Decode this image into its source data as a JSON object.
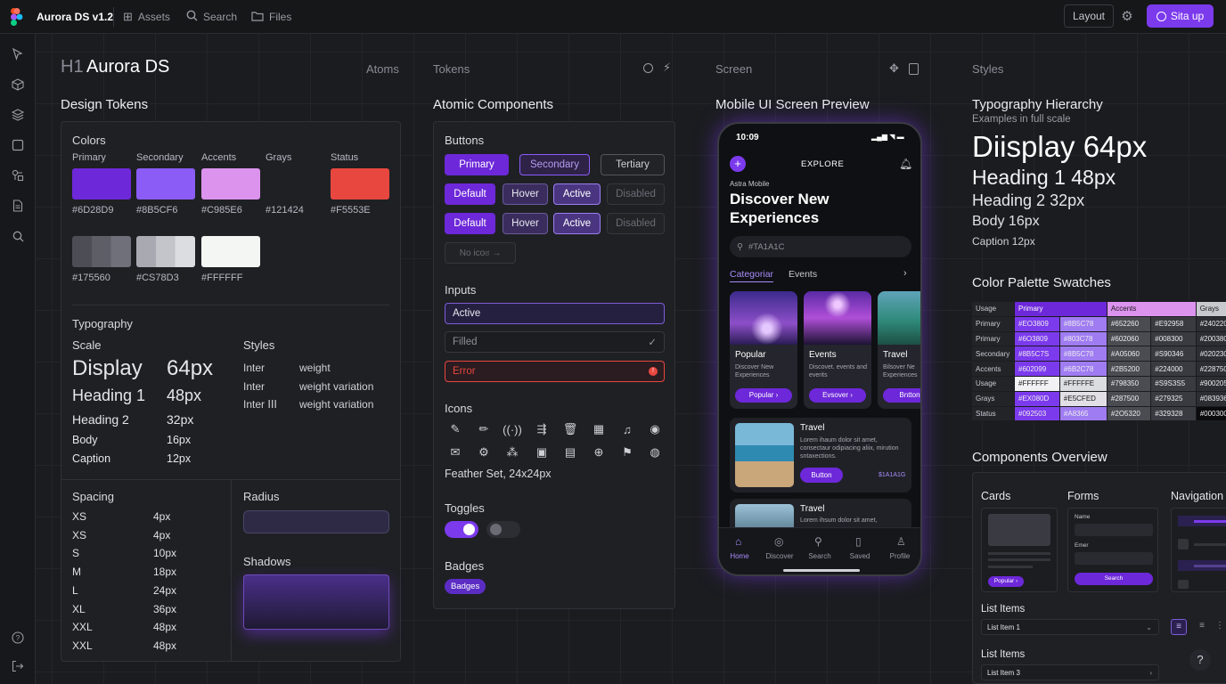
{
  "topbar": {
    "app_title": "Aurora DS v1.2",
    "assets": "Assets",
    "search": "Search",
    "files": "Files",
    "layout": "Layout",
    "signup": "Sita up"
  },
  "canvas_headers": {
    "title_prefix": "H1",
    "title": "Aurora DS",
    "atoms": "Atoms",
    "tokens": "Tokens",
    "screen": "Screen",
    "styles": "Styles"
  },
  "tokens": {
    "title": "Design Tokens",
    "colors_title": "Colors",
    "swatches": [
      {
        "name": "Primary",
        "hex": "#6D28D9",
        "color": "#6d28d9"
      },
      {
        "name": "Secondary",
        "hex": "#8B5CF6",
        "color": "#8b5cf6"
      },
      {
        "name": "Accents",
        "hex": "#C985E6",
        "color": "#dc93ee"
      },
      {
        "name": "Grays",
        "hex": "#121424",
        "color": "#1f2024"
      },
      {
        "name": "Status",
        "hex": "#F5553E",
        "color": "#e8473f"
      }
    ],
    "grays": [
      {
        "hex": "#175560"
      },
      {
        "hex": "#CS78D3"
      },
      {
        "hex": "#FFFFFF"
      }
    ],
    "typography_title": "Typography",
    "scale_title": "Scale",
    "styles_title": "Styles",
    "scale": [
      {
        "name": "Display",
        "size": "64px"
      },
      {
        "name": "Heading 1",
        "size": "48px"
      },
      {
        "name": "Heading 2",
        "size": "32px"
      },
      {
        "name": "Body",
        "size": "16px"
      },
      {
        "name": "Caption",
        "size": "12px"
      }
    ],
    "styles": [
      {
        "font": "Inter",
        "desc": "weight"
      },
      {
        "font": "Inter",
        "desc": "weight variation"
      },
      {
        "font": "Inter ⅠⅠⅠ",
        "desc": "weight variation"
      }
    ],
    "spacing_title": "Spacing",
    "spacing": [
      {
        "k": "XS",
        "v": "4px"
      },
      {
        "k": "XS",
        "v": "4px"
      },
      {
        "k": "S",
        "v": "10px"
      },
      {
        "k": "M",
        "v": "18px"
      },
      {
        "k": "L",
        "v": "24px"
      },
      {
        "k": "XL",
        "v": "36px"
      },
      {
        "k": "XXL",
        "v": "48px"
      },
      {
        "k": "XXL",
        "v": "48px"
      }
    ],
    "radius_title": "Radius",
    "shadows_title": "Shadows"
  },
  "atomic": {
    "title": "Atomic Components",
    "buttons_title": "Buttons",
    "row1": [
      "Primary",
      "Secondary",
      "Tertiary"
    ],
    "row2": [
      "Default",
      "Hover",
      "Active",
      "Disabled"
    ],
    "row3": [
      "Default",
      "Hover",
      "Active",
      "Disabled"
    ],
    "no_icon": "No icoಠ →",
    "inputs_title": "Inputs",
    "input_active": "Active",
    "input_filled": "Filled",
    "input_error": "Error",
    "icons_title": "Icons",
    "icons_caption": "Feather Set, 24x24px",
    "toggles_title": "Toggles",
    "badges_title": "Badges",
    "badge_label": "Badges"
  },
  "mobile": {
    "title": "Mobile UI Screen Preview",
    "time": "10:09",
    "header": "EXPLORE",
    "app_name": "Astra Mobile",
    "headline_1": "Discover New",
    "headline_2": "Experiences",
    "search_placeholder": "#TA1A1C",
    "tab_categories": "Categoriar",
    "tab_events": "Events",
    "cards": [
      {
        "title": "Popular",
        "desc": "Discover New Experiences",
        "button": "Popular ›"
      },
      {
        "title": "Events",
        "desc": "Discovet. events and everits",
        "button": "Evsover ›"
      },
      {
        "title": "Travel",
        "desc": "Bilsover Ne Experiences",
        "button": "Bnttons"
      }
    ],
    "list": [
      {
        "title": "Travel",
        "desc": "Lorem ihaum dolor sit amet, consectaur odipiacing aliix, mirution sntaxections.",
        "button": "Button",
        "code": "$1A1A1G"
      },
      {
        "title": "Travel",
        "desc": "Lorem ihsum dolor sit amet,"
      }
    ],
    "nav": [
      "Home",
      "Discover",
      "Search",
      "Saved",
      "Profile"
    ]
  },
  "styles_panel": {
    "typo_title": "Typography Hierarchy",
    "typo_sub": "Examples in full scale",
    "display": "Diisplay 64px",
    "h1": "Heading 1 48px",
    "h2": "Heading 2 32px",
    "body": "Body 16px",
    "caption": "Caption 12px",
    "palette_title": "Color Palette Swatches",
    "table_header": [
      "Usage",
      "Primary",
      "Accents",
      "Grays"
    ],
    "table_rows": [
      [
        "Primary",
        "#EO3809",
        "#8B5C78",
        "#652260",
        "#E92958",
        "#240220"
      ],
      [
        "Primary",
        "#6O3809",
        "#803C78",
        "#602060",
        "#008300",
        "#200380"
      ],
      [
        "Secondary",
        "#8B5C7S",
        "#8B5C78",
        "#A05060",
        "#S90346",
        "#020230"
      ],
      [
        "Accents",
        "#602099",
        "#6B2C78",
        "#2B5200",
        "#224000",
        "#228750"
      ],
      [
        "Usage",
        "#FFFFFF",
        "#FFFFFE",
        "#798350",
        "#S9S3S5",
        "#900205"
      ],
      [
        "Grays",
        "#EX080D",
        "#E5CFED",
        "#287500",
        "#279325",
        "#083936"
      ],
      [
        "Status",
        "#092503",
        "#A8365",
        "#2O5320",
        "#329328",
        "#000300"
      ]
    ],
    "components_title": "Components Overview",
    "cards": "Cards",
    "forms": "Forms",
    "navigation": "Navigation",
    "form_name": "Name",
    "form_enter": "Emer",
    "form_search": "Search",
    "popular_chip": "Popular ›",
    "list_items_title": "List Items",
    "list_item_1": "List Item 1",
    "list_items_title_2": "List Items",
    "list_item_3": "List Item 3"
  }
}
